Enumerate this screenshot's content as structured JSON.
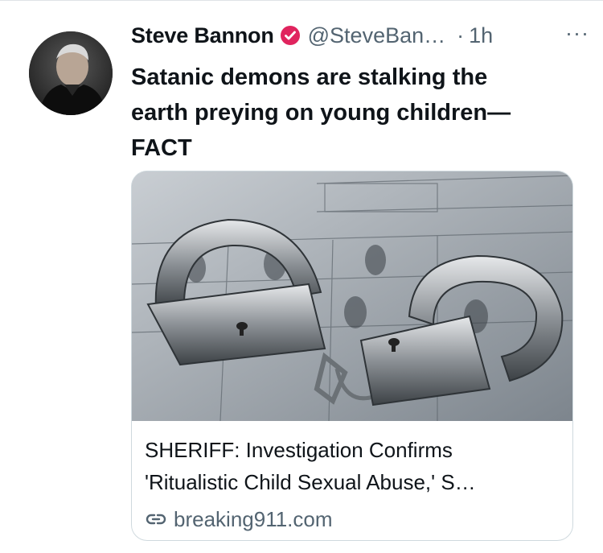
{
  "tweet": {
    "author_name": "Steve Bannon",
    "handle": "@SteveBan…",
    "separator": "·",
    "time": "1h",
    "more_label": "···",
    "text": "Satanic demons are stalking the\nearth preying on young children—\nFACT"
  },
  "card": {
    "title": "SHERIFF: Investigation Confirms\n'Ritualistic Child Sexual Abuse,' S…",
    "domain": "breaking911.com",
    "image_icon": "handcuffs-on-fingerprint-card"
  },
  "icons": {
    "verified": "verified-badge-icon",
    "link": "link-icon"
  },
  "colors": {
    "verified_badge": "#e0245e",
    "secondary_text": "#536471",
    "border": "#cfd9de"
  }
}
